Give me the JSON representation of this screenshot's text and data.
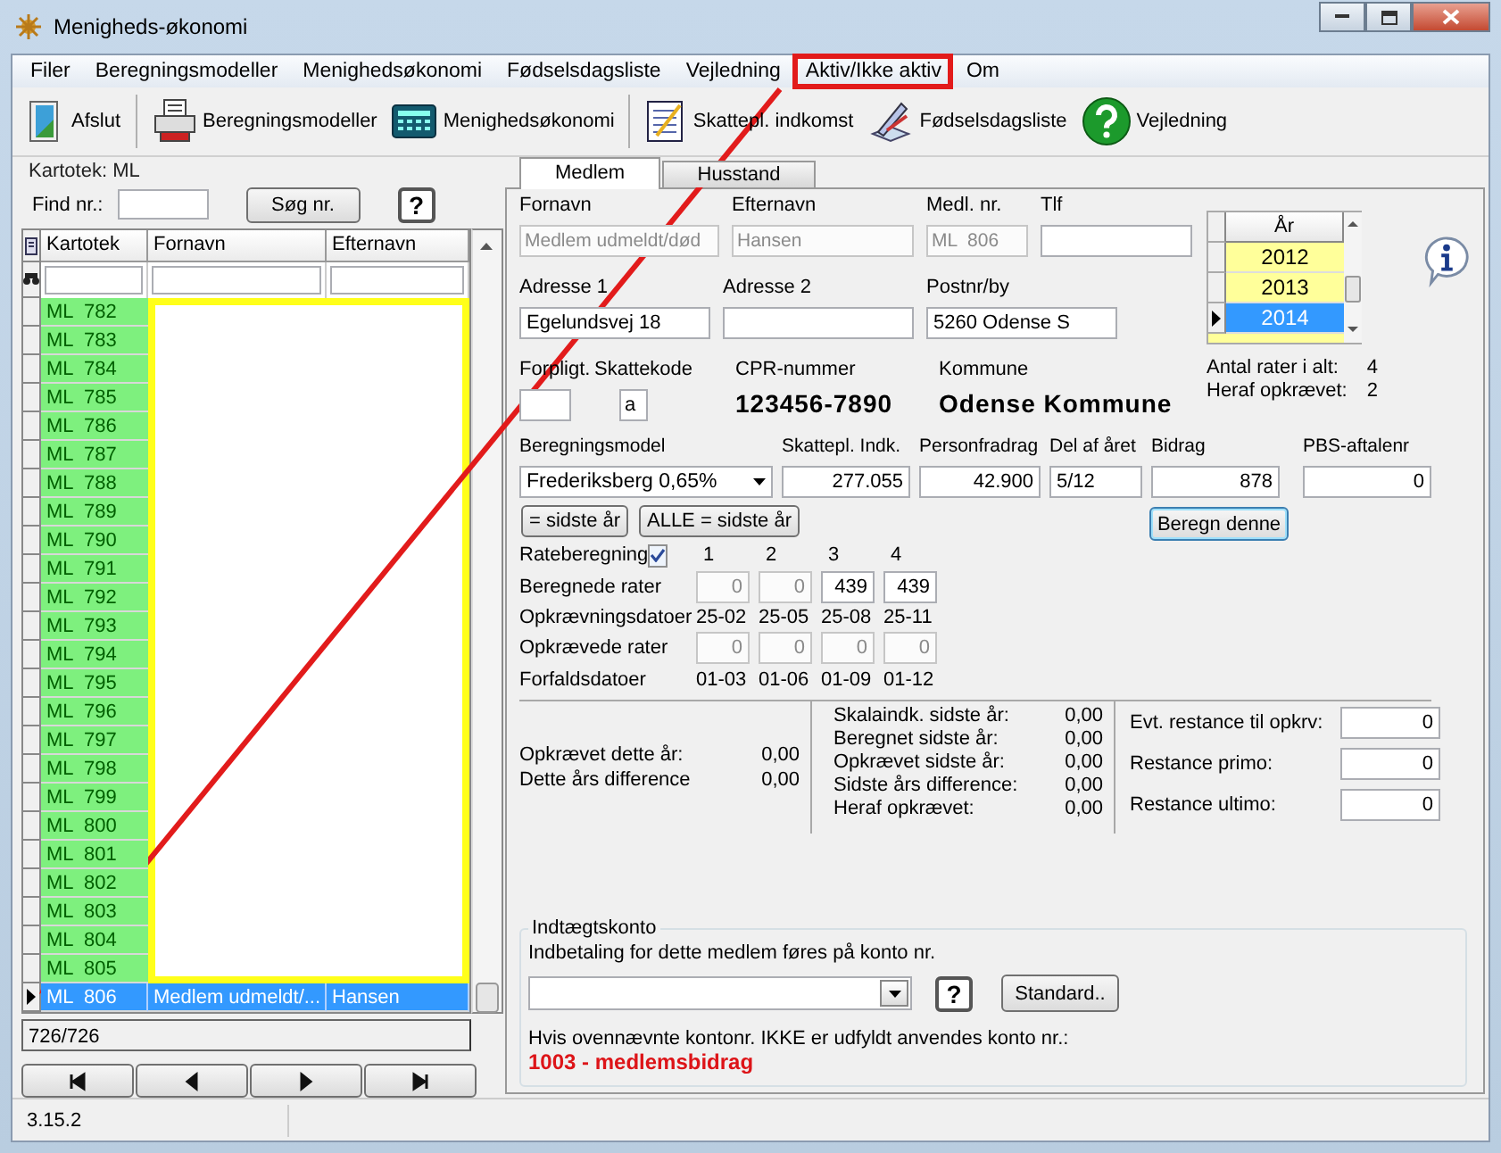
{
  "window": {
    "title": "Menigheds-økonomi"
  },
  "menu": [
    {
      "label": "Filer",
      "highlighted": false
    },
    {
      "label": "Beregningsmodeller",
      "highlighted": false
    },
    {
      "label": "Menighedsøkonomi",
      "highlighted": false
    },
    {
      "label": "Fødselsdagsliste",
      "highlighted": false
    },
    {
      "label": "Vejledning",
      "highlighted": false
    },
    {
      "label": "Aktiv/Ikke aktiv",
      "highlighted": true
    },
    {
      "label": "Om",
      "highlighted": false
    }
  ],
  "toolbar": [
    {
      "label": "Afslut",
      "kind": "exit",
      "separator_after": true
    },
    {
      "label": "Beregningsmodeller",
      "kind": "models",
      "separator_after": false
    },
    {
      "label": "Menighedsøkonomi",
      "kind": "calculator",
      "separator_after": true
    },
    {
      "label": "Skattepl. indkomst",
      "kind": "form",
      "separator_after": false
    },
    {
      "label": "Fødselsdagsliste",
      "kind": "tools",
      "separator_after": false
    },
    {
      "label": "Vejledning",
      "kind": "help",
      "separator_after": false
    }
  ],
  "left_panel": {
    "group_title": "Kartotek: ML",
    "find_label": "Find nr.:",
    "search_button": "Søg nr.",
    "help_button": "?",
    "columns": [
      "Kartotek",
      "Fornavn",
      "Efternavn"
    ],
    "redaction_box": true,
    "rows": [
      {
        "kartotek": "ML  782",
        "selected": false
      },
      {
        "kartotek": "ML  783",
        "selected": false
      },
      {
        "kartotek": "ML  784",
        "selected": false
      },
      {
        "kartotek": "ML  785",
        "selected": false
      },
      {
        "kartotek": "ML  786",
        "selected": false
      },
      {
        "kartotek": "ML  787",
        "selected": false
      },
      {
        "kartotek": "ML  788",
        "selected": false
      },
      {
        "kartotek": "ML  789",
        "selected": false
      },
      {
        "kartotek": "ML  790",
        "selected": false
      },
      {
        "kartotek": "ML  791",
        "selected": false
      },
      {
        "kartotek": "ML  792",
        "selected": false
      },
      {
        "kartotek": "ML  793",
        "selected": false
      },
      {
        "kartotek": "ML  794",
        "selected": false
      },
      {
        "kartotek": "ML  795",
        "selected": false
      },
      {
        "kartotek": "ML  796",
        "selected": false
      },
      {
        "kartotek": "ML  797",
        "selected": false
      },
      {
        "kartotek": "ML  798",
        "selected": false
      },
      {
        "kartotek": "ML  799",
        "selected": false
      },
      {
        "kartotek": "ML  800",
        "selected": false
      },
      {
        "kartotek": "ML  801",
        "selected": false
      },
      {
        "kartotek": "ML  802",
        "selected": false
      },
      {
        "kartotek": "ML  803",
        "selected": false
      },
      {
        "kartotek": "ML  804",
        "selected": false
      },
      {
        "kartotek": "ML  805",
        "selected": false
      },
      {
        "kartotek": "ML  806",
        "fornavn": "Medlem udmeldt/...",
        "efternavn": "Hansen",
        "selected": true
      }
    ],
    "record_count": "726/726",
    "nav_buttons": [
      {
        "kind": "first"
      },
      {
        "kind": "previous"
      },
      {
        "kind": "next"
      },
      {
        "kind": "last"
      }
    ]
  },
  "tabs": [
    {
      "label": "Medlem",
      "selected": true
    },
    {
      "label": "Husstand",
      "selected": false
    }
  ],
  "member": {
    "row1": [
      {
        "label": "Fornavn",
        "value": "Medlem udmeldt/død",
        "disabled": true
      },
      {
        "label": "Efternavn",
        "value": "Hansen",
        "disabled": true
      },
      {
        "label": "Medl. nr.",
        "value": "ML  806",
        "disabled": true
      },
      {
        "label": "Tlf",
        "disabled": false
      }
    ],
    "row2": [
      {
        "label": "Adresse 1",
        "value": "Egelundsvej 18",
        "disabled": false
      },
      {
        "label": "Adresse 2",
        "disabled": false
      },
      {
        "label": "Postnr/by",
        "value": "5260 Odense S",
        "disabled": false
      }
    ],
    "forpligt": {
      "label": "Forpligt."
    },
    "skattekode": {
      "label": "Skattekode",
      "value": "a"
    },
    "cpr": {
      "label": "CPR-nummer",
      "value": "123456-7890"
    },
    "kommune": {
      "label": "Kommune",
      "value": "Odense Kommune"
    },
    "years": {
      "header": "År",
      "items": [
        {
          "label": "2012",
          "selected": false
        },
        {
          "label": "2013",
          "selected": false
        },
        {
          "label": "2014",
          "selected": true
        }
      ]
    },
    "rate_info": [
      {
        "label": "Antal rater i alt:",
        "value": "4"
      },
      {
        "label": "Heraf opkrævet:",
        "value": "2"
      }
    ],
    "calc_fields": [
      {
        "label": "Beregningsmodel",
        "value": "Frederiksberg 0,65%",
        "kind": "dropdown"
      },
      {
        "label": "Skattepl. Indk.",
        "value": "277.055",
        "kind": "number"
      },
      {
        "label": "Personfradrag",
        "value": "42.900",
        "kind": "number"
      },
      {
        "label": "Del af året",
        "value": "5/12",
        "kind": "text"
      },
      {
        "label": "Bidrag",
        "value": "878",
        "kind": "number"
      },
      {
        "label": "PBS-aftalenr",
        "value": "0",
        "kind": "number"
      }
    ],
    "copy_buttons": [
      "= sidste år",
      "ALLE = sidste år"
    ],
    "calc_button": "Beregn denne",
    "rates": {
      "label": "Rateberegning",
      "checked": true,
      "columns": [
        "1",
        "2",
        "3",
        "4"
      ],
      "rows": [
        {
          "label": "Beregnede rater",
          "kind": "inputs",
          "cells": [
            {
              "value": "0",
              "disabled": true
            },
            {
              "value": "0",
              "disabled": true
            },
            {
              "value": "439",
              "disabled": false
            },
            {
              "value": "439",
              "disabled": false
            }
          ]
        },
        {
          "label": "Opkrævningsdatoer",
          "kind": "dates",
          "cells": [
            {
              "value": "25-02"
            },
            {
              "value": "25-05"
            },
            {
              "value": "25-08"
            },
            {
              "value": "25-11"
            }
          ]
        },
        {
          "label": "Opkrævede rater",
          "kind": "inputs",
          "cells": [
            {
              "value": "0",
              "disabled": true
            },
            {
              "value": "0",
              "disabled": true
            },
            {
              "value": "0",
              "disabled": true
            },
            {
              "value": "0",
              "disabled": true
            }
          ]
        },
        {
          "label": "Forfaldsdatoer",
          "kind": "dates",
          "cells": [
            {
              "value": "01-03"
            },
            {
              "value": "01-06"
            },
            {
              "value": "01-09"
            },
            {
              "value": "01-12"
            }
          ]
        }
      ]
    },
    "summary_left": [
      {
        "label": "Opkrævet dette år:",
        "value": "0,00"
      },
      {
        "label": "Dette års difference",
        "value": "0,00"
      }
    ],
    "summary_middle": [
      {
        "label": "Skalaindk. sidste år:",
        "value": "0,00"
      },
      {
        "label": "Beregnet sidste år:",
        "value": "0,00"
      },
      {
        "label": "Opkrævet sidste år:",
        "value": "0,00"
      },
      {
        "label": "Sidste års difference:",
        "value": "0,00"
      },
      {
        "label": "Heraf opkrævet:",
        "value": "0,00"
      }
    ],
    "summary_right": [
      {
        "label": "Evt. restance til opkrv:",
        "value": "0"
      },
      {
        "label": "Restance primo:",
        "value": "0"
      },
      {
        "label": "Restance ultimo:",
        "value": "0"
      }
    ]
  },
  "income_account": {
    "title": "Indtægtskonto",
    "instruction": "Indbetaling for dette medlem føres på konto nr.",
    "help_button": "?",
    "standard_button": "Standard..",
    "note": "Hvis ovennævnte kontonr. IKKE er udfyldt anvendes konto nr.:",
    "default_account": "1003 - medlemsbidrag"
  },
  "status_bar": {
    "version": "3.15.2"
  },
  "annotation": {
    "arrow": true
  }
}
